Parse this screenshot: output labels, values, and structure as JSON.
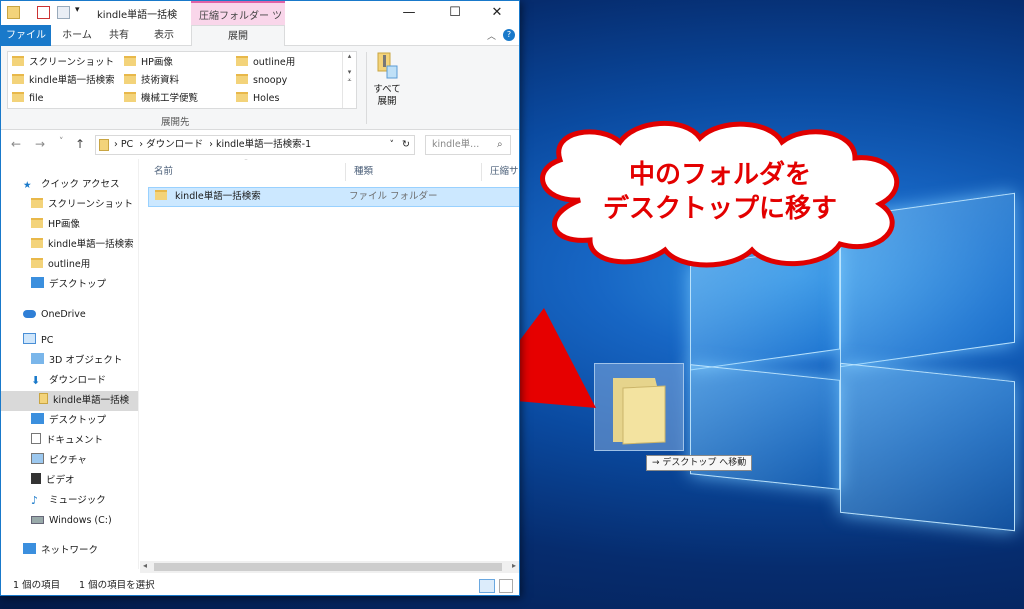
{
  "explorer": {
    "title": "kindle単語一括検",
    "context_tab": "圧縮フォルダー ツール",
    "window_controls": {
      "minimize": "—",
      "maximize": "☐",
      "close": "✕"
    },
    "ribbon_tabs": [
      "ファイル",
      "ホーム",
      "共有",
      "表示",
      "展開"
    ],
    "destinations": {
      "col1": [
        "スクリーンショット",
        "kindle単語一括検索",
        "file"
      ],
      "col2": [
        "HP画像",
        "技術資料",
        "機械工学便覧"
      ],
      "col3": [
        "outline用",
        "snoopy",
        "Holes"
      ],
      "group_label": "展開先"
    },
    "extract_all": {
      "line1": "すべて",
      "line2": "展開"
    },
    "address": {
      "path": [
        "PC",
        "ダウンロード",
        "kindle単語一括検索-1"
      ],
      "search_placeholder": "kindle単..."
    },
    "nav": {
      "quick_access": "クイック アクセス",
      "qa_items": [
        "スクリーンショット",
        "HP画像",
        "kindle単語一括検索",
        "outline用",
        "デスクトップ"
      ],
      "onedrive": "OneDrive",
      "pc": "PC",
      "pc_items": [
        "3D オブジェクト",
        "ダウンロード",
        "kindle単語一括検",
        "デスクトップ",
        "ドキュメント",
        "ピクチャ",
        "ビデオ",
        "ミュージック",
        "Windows (C:)"
      ],
      "network": "ネットワーク"
    },
    "columns": [
      "名前",
      "種類",
      "圧縮サ"
    ],
    "files": [
      {
        "name": "kindle単語一括検索",
        "type": "ファイル フォルダー"
      }
    ],
    "status": {
      "count": "1 個の項目",
      "selected": "1 個の項目を選択"
    }
  },
  "desktop": {
    "callout_line1": "中のフォルダを",
    "callout_line2": "デスクトップに移す",
    "drag_tooltip": "→ デスクトップ へ移動"
  },
  "colors": {
    "accent": "#1979ca",
    "callout_text": "#e30000",
    "arrow": "#e60000"
  }
}
